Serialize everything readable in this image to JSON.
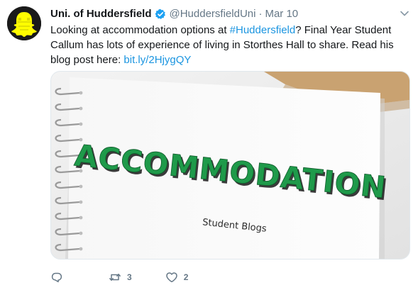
{
  "user": {
    "name": "Uni. of Huddersfield",
    "handle": "@HuddersfieldUni",
    "separator": "·",
    "time": "Mar 10"
  },
  "tweet": {
    "text_1": "Looking at accommodation options at ",
    "hashtag": "#Huddersfield",
    "text_2": "?  Final Year Student Callum has lots of experience of living in Storthes Hall to share.  Read his blog post here: ",
    "link": "bit.ly/2HjygQY"
  },
  "media": {
    "headline": "ACCOMMODATION",
    "subtitle": "Student Blogs"
  },
  "actions": {
    "retweet_count": "3",
    "like_count": "2"
  },
  "colors": {
    "link": "#1b95e0",
    "verified": "#1da1f2",
    "avatar_bg": "#1a1a1a",
    "avatar_ghost": "#fffc00",
    "headline_green": "#1f9a4a",
    "muted": "#657786"
  },
  "icons": {
    "avatar": "snapchat-ghost-icon",
    "verified": "verified-badge-icon",
    "caret": "chevron-down-icon",
    "reply": "reply-icon",
    "retweet": "retweet-icon",
    "like": "heart-icon"
  }
}
